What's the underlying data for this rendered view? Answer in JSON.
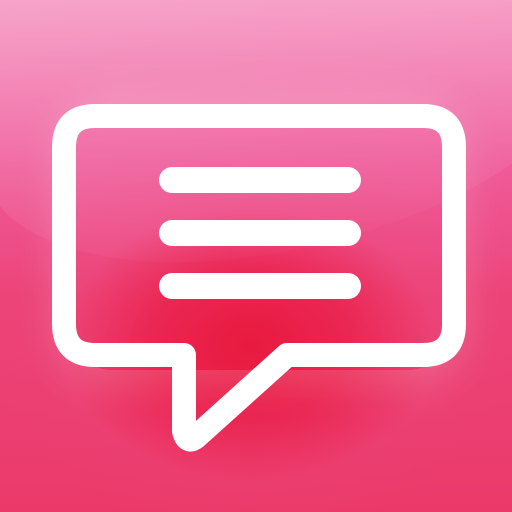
{
  "icon": {
    "name": "chat-bubble-icon",
    "background_gradient": [
      "#f48abb",
      "#ef5b9a",
      "#ec4479",
      "#eb3a6a"
    ],
    "accent_color": "#e8163a",
    "glyph_color": "#ffffff",
    "line_count": 3
  }
}
